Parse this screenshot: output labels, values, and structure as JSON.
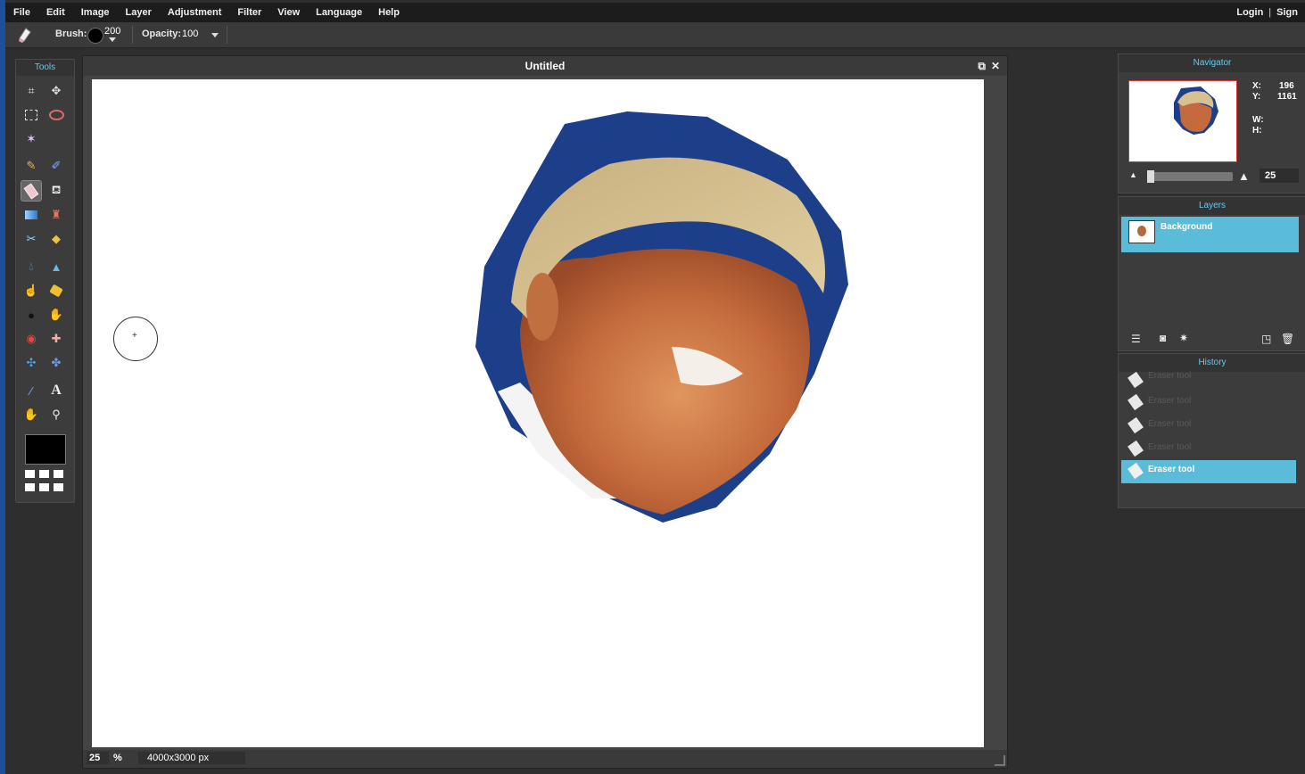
{
  "menu": {
    "items": [
      "File",
      "Edit",
      "Image",
      "Layer",
      "Adjustment",
      "Filter",
      "View",
      "Language",
      "Help"
    ],
    "login": "Login",
    "separator": "|",
    "signup": "Sign"
  },
  "options": {
    "brush_label": "Brush:",
    "brush_size": "200",
    "opacity_label": "Opacity:",
    "opacity_value": "100"
  },
  "tools": {
    "title": "Tools",
    "active": "eraser-tool",
    "foreground_color": "#000000"
  },
  "document": {
    "title": "Untitled",
    "zoom": "25",
    "zoom_unit": "%",
    "dimensions": "4000x3000 px"
  },
  "navigator": {
    "title": "Navigator",
    "x_label": "X:",
    "x_value": "196",
    "y_label": "Y:",
    "y_value": "1161",
    "w_label": "W:",
    "h_label": "H:",
    "zoom": "25"
  },
  "layers": {
    "title": "Layers",
    "items": [
      {
        "name": "Background"
      }
    ]
  },
  "history": {
    "title": "History",
    "items": [
      {
        "label": "Eraser tool"
      },
      {
        "label": "Eraser tool"
      },
      {
        "label": "Eraser tool"
      },
      {
        "label": "Eraser tool"
      },
      {
        "label": "Eraser tool"
      }
    ]
  },
  "colors": {
    "accent": "#5bbcd9",
    "panel_title": "#6cc7e8"
  }
}
